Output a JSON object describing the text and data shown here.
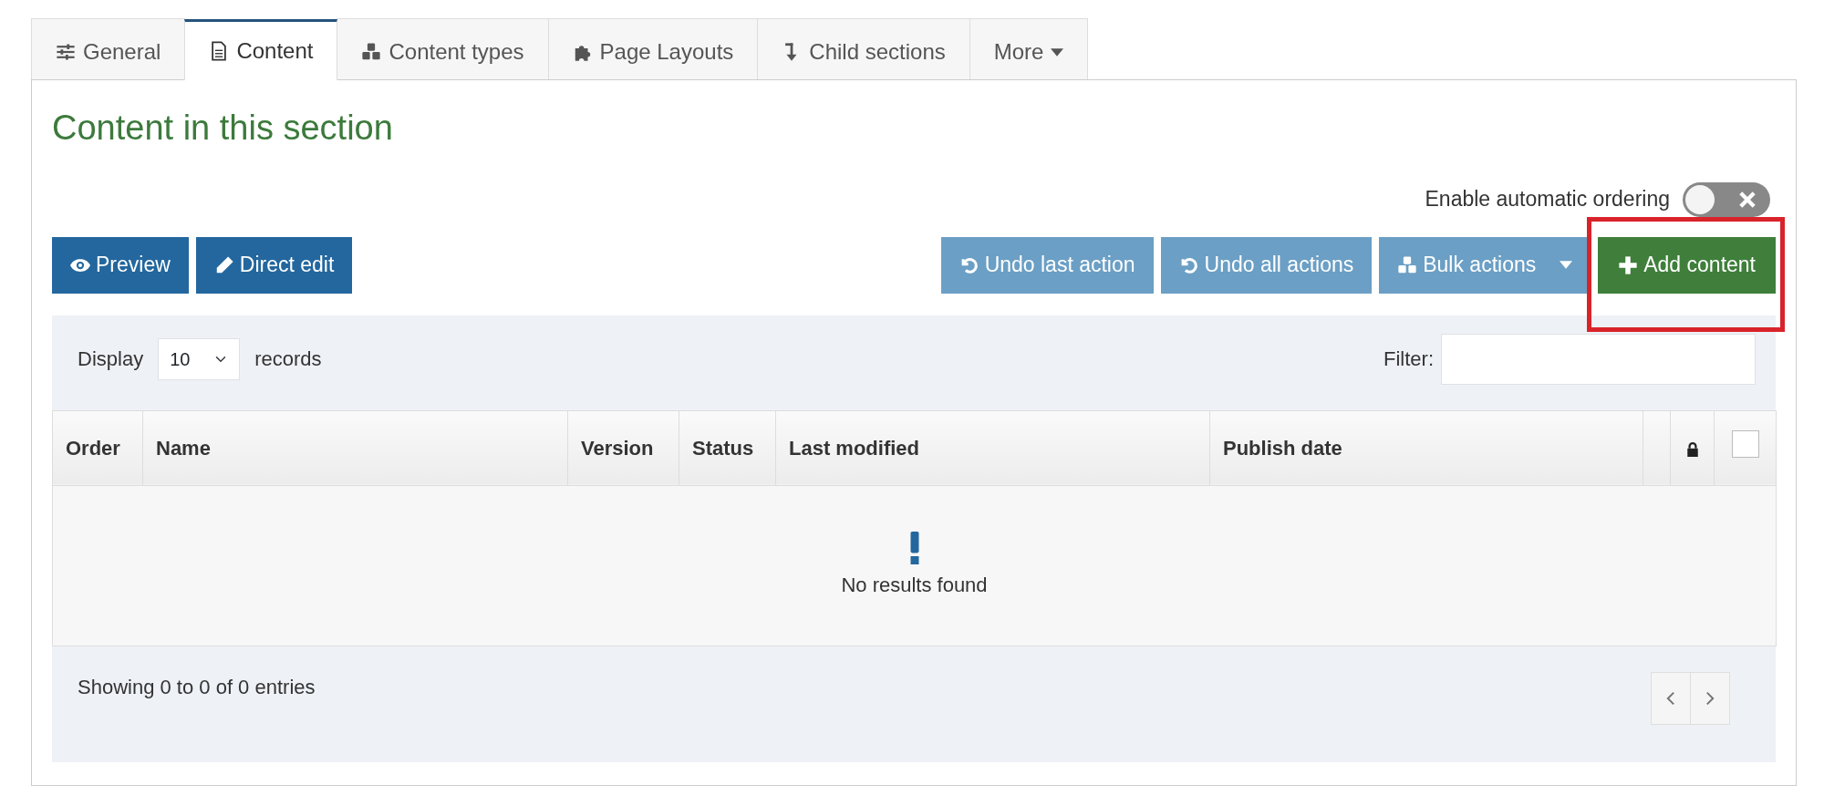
{
  "tabs": [
    {
      "label": "General",
      "selected": false,
      "dropdown": false
    },
    {
      "label": "Content",
      "selected": true,
      "dropdown": false
    },
    {
      "label": "Content types",
      "selected": false,
      "dropdown": false
    },
    {
      "label": "Page Layouts",
      "selected": false,
      "dropdown": false
    },
    {
      "label": "Child sections",
      "selected": false,
      "dropdown": false
    },
    {
      "label": "More",
      "selected": false,
      "dropdown": true
    }
  ],
  "heading": "Content in this section",
  "auto_ordering": {
    "label": "Enable automatic ordering",
    "on": false
  },
  "left_buttons": [
    {
      "label": "Preview",
      "disabled": false
    },
    {
      "label": "Direct edit",
      "disabled": false
    }
  ],
  "right_buttons": [
    {
      "label": "Undo last action",
      "disabled": true,
      "kind": "plain"
    },
    {
      "label": "Undo all actions",
      "disabled": true,
      "kind": "plain"
    },
    {
      "label": "Bulk actions",
      "disabled": true,
      "kind": "dropdown"
    },
    {
      "label": "Add content",
      "disabled": false,
      "kind": "add",
      "highlighted": true
    }
  ],
  "length_menu": {
    "before": "Display",
    "value": "10",
    "after": "records"
  },
  "filter": {
    "label": "Filter:"
  },
  "table": {
    "columns": [
      {
        "label": "Order"
      },
      {
        "label": "Name"
      },
      {
        "label": "Version"
      },
      {
        "label": "Status"
      },
      {
        "label": "Last modified"
      },
      {
        "label": "Publish date"
      },
      {
        "kind": "blank"
      },
      {
        "kind": "lock"
      },
      {
        "kind": "checkbox",
        "checked": false
      }
    ],
    "empty_message": "No results found"
  },
  "info": "Showing 0 to 0 of 0 entries",
  "pagination": [
    {
      "kind": "previous",
      "disabled": true
    },
    {
      "kind": "next",
      "disabled": true
    }
  ]
}
